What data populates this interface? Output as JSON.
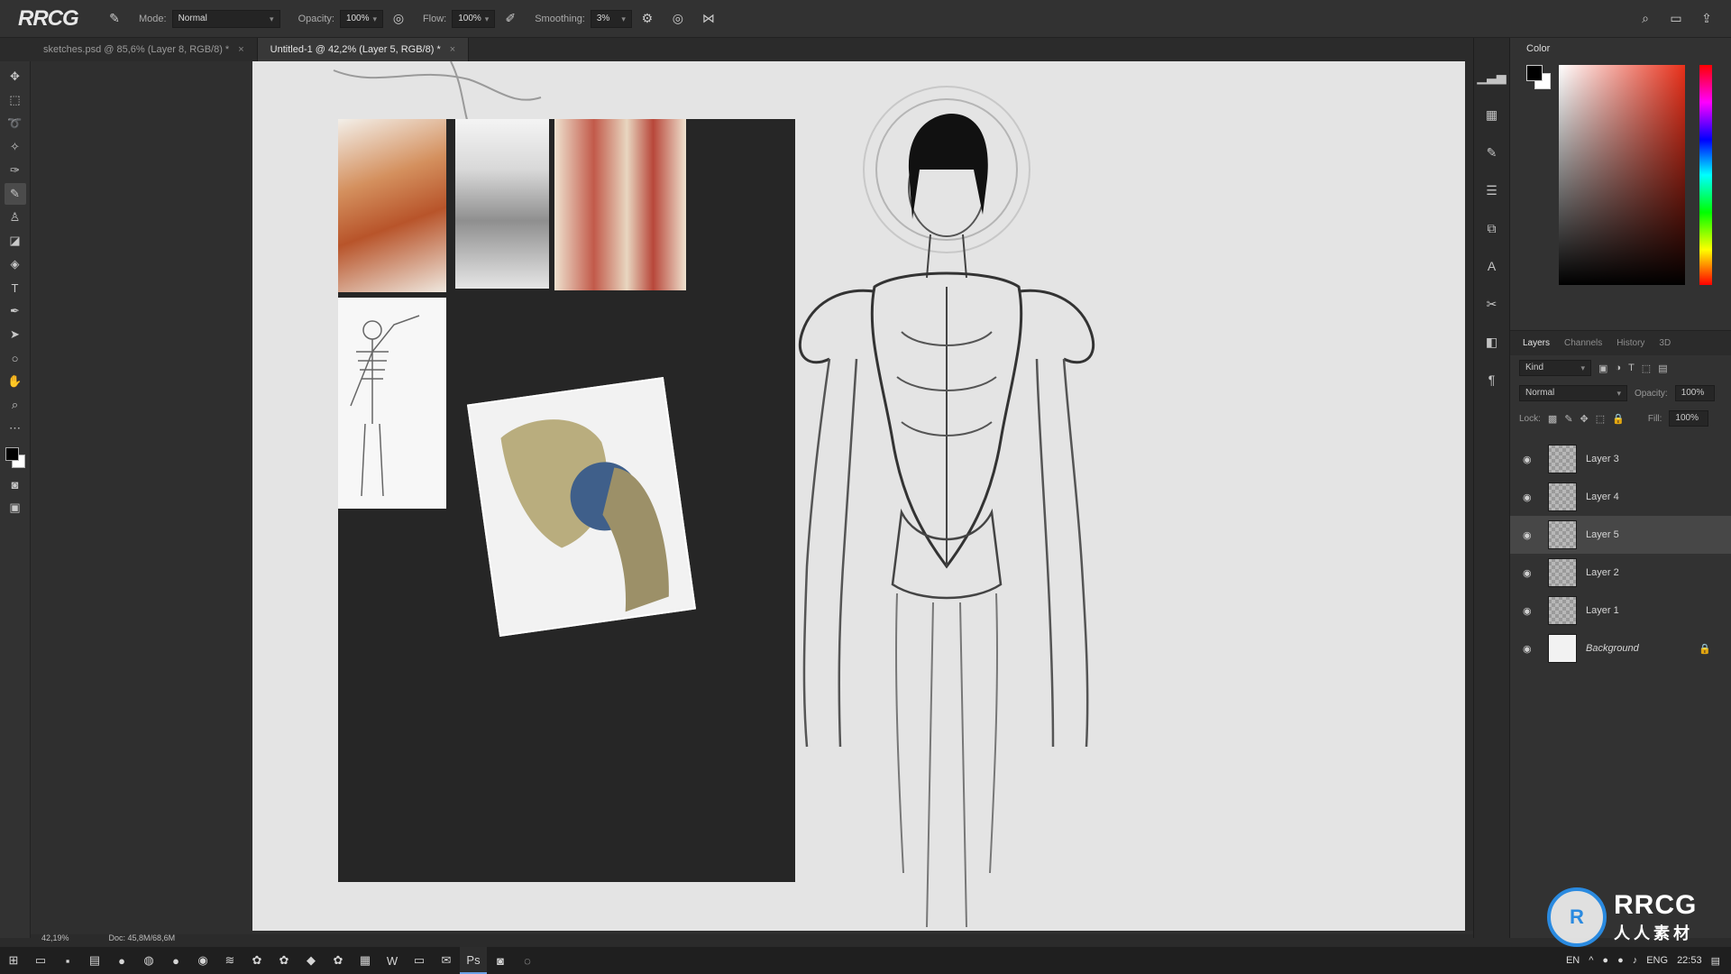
{
  "app": {
    "logo": "RRCG"
  },
  "options": {
    "mode_label": "Mode:",
    "mode_value": "Normal",
    "opacity_label": "Opacity:",
    "opacity_value": "100%",
    "flow_label": "Flow:",
    "flow_value": "100%",
    "smoothing_label": "Smoothing:",
    "smoothing_value": "3%"
  },
  "tabs": [
    {
      "label": "sketches.psd @ 85,6% (Layer 8, RGB/8) *"
    },
    {
      "label": "Untitled-1 @ 42,2% (Layer 5, RGB/8) *"
    }
  ],
  "panels": {
    "color_title": "Color",
    "layers_tabs": [
      "Layers",
      "Channels",
      "History",
      "3D"
    ],
    "kind_label": "Kind",
    "blend_mode": "Normal",
    "opacity_label": "Opacity:",
    "opacity_value": "100%",
    "lock_label": "Lock:",
    "fill_label": "Fill:",
    "fill_value": "100%",
    "layers": [
      {
        "name": "Layer 3"
      },
      {
        "name": "Layer 4"
      },
      {
        "name": "Layer 5"
      },
      {
        "name": "Layer 2"
      },
      {
        "name": "Layer 1"
      },
      {
        "name": "Background"
      }
    ]
  },
  "status": {
    "zoom": "42,19%",
    "doc": "Doc: 45,8M/68,6M"
  },
  "taskbar": {
    "lang": "EN",
    "lang2": "ENG",
    "time": "22:53"
  },
  "watermark": {
    "t1": "RRCG",
    "t2": "人人素材"
  },
  "colors": {
    "accent": "#2a8ae0",
    "canvas_bg": "#e4e4e4",
    "panel_bg": "#323232"
  }
}
